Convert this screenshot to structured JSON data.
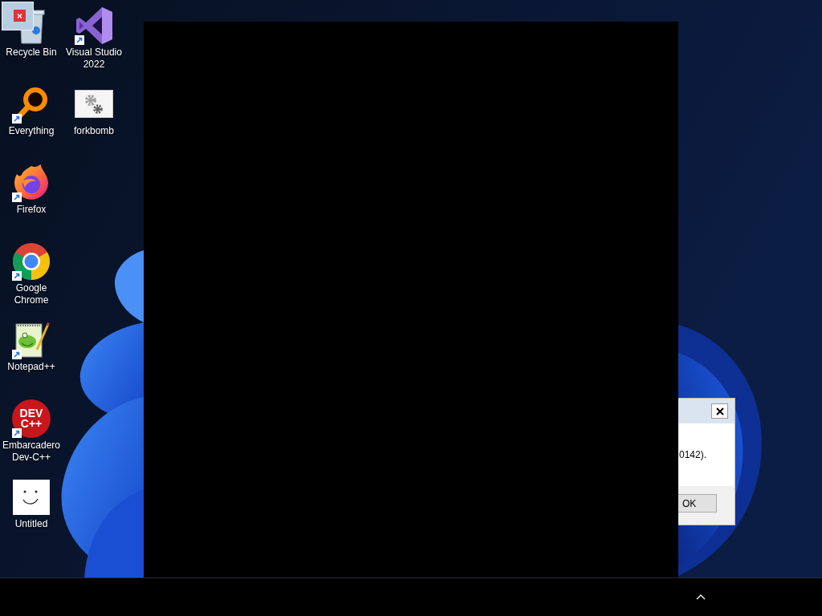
{
  "desktop_icons": [
    {
      "label": "Recycle Bin",
      "shortcut": false
    },
    {
      "label": "Everything",
      "shortcut": true
    },
    {
      "label": "Firefox",
      "shortcut": true
    },
    {
      "label": "Google Chrome",
      "shortcut": true
    },
    {
      "label": "Notepad++",
      "shortcut": true
    },
    {
      "label": "Embarcadero Dev-C++",
      "shortcut": true,
      "logo_text": "DEV C++"
    },
    {
      "label": "Untitled",
      "shortcut": false
    },
    {
      "label": "Visual Studio 2022",
      "shortcut": true
    },
    {
      "label": "forkbomb",
      "shortcut": false
    }
  ],
  "dialog": {
    "message": "0142).",
    "buttons": [
      "OK"
    ]
  }
}
